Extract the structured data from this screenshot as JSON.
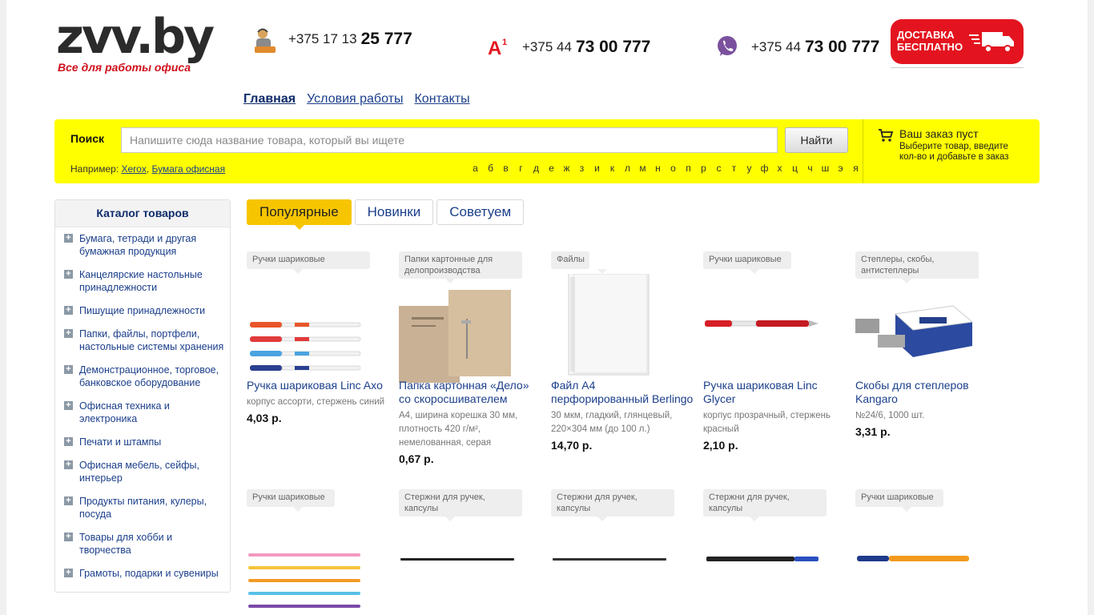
{
  "header": {
    "logo": "zvv.by",
    "tagline": "Все для работы офиса",
    "phones": [
      {
        "prefix": "+375 17 13",
        "main": "25 777",
        "icon": "operator-icon"
      },
      {
        "prefix": "+375 44",
        "main": "73 00 777",
        "icon": "a1-icon"
      },
      {
        "prefix": "+375 44",
        "main": "73 00 777",
        "icon": "viber-icon"
      }
    ],
    "delivery": {
      "line1": "ДОСТАВКА",
      "line2": "БЕСПЛАТНО"
    }
  },
  "nav": {
    "home": "Главная",
    "terms": "Условия работы",
    "contacts": "Контакты"
  },
  "search": {
    "label": "Поиск",
    "placeholder": "Напишите сюда название товара, который вы ищете",
    "button": "Найти",
    "example_label": "Например:",
    "example1": "Xerox",
    "example2": "Бумага офисная",
    "alphabet": [
      "а",
      "б",
      "в",
      "г",
      "д",
      "е",
      "ж",
      "з",
      "и",
      "к",
      "л",
      "м",
      "н",
      "о",
      "п",
      "р",
      "с",
      "т",
      "у",
      "ф",
      "х",
      "ц",
      "ч",
      "ш",
      "э",
      "я"
    ]
  },
  "cart": {
    "title": "Ваш заказ пуст",
    "subtitle": "Выберите товар, введите кол-во и добавьте в заказ"
  },
  "sidebar": {
    "title": "Каталог товаров",
    "items": [
      "Бумага, тетради и другая бумажная продукция",
      "Канцелярские настольные принадлежности",
      "Пишущие принадлежности",
      "Папки, файлы, портфели, настольные системы хранения",
      "Демонстрационное, торговое, банковское оборудование",
      "Офисная техника и электроника",
      "Печати и штампы",
      "Офисная мебель, сейфы, интерьер",
      "Продукты питания, кулеры, посуда",
      "Товары для хобби и творчества",
      "Грамоты, подарки и сувениры"
    ]
  },
  "tabs": [
    "Популярные",
    "Новинки",
    "Советуем"
  ],
  "products": [
    {
      "category": "Ручки шариковые",
      "name": "Ручка шариковая Linc Axo",
      "desc": "корпус ассорти, стержень синий",
      "price": "4,03 р."
    },
    {
      "category": "Папки картонные для делопроизводства",
      "name": "Папка картонная «Дело» со скоросшивателем",
      "desc": "А4, ширина корешка 30 мм, плотность 420 г/м², немелованная, серая",
      "price": "0,67 р."
    },
    {
      "category": "Файлы",
      "name": "Файл А4 перфорированный Berlingo",
      "desc": "30 мкм, гладкий, глянцевый, 220×304 мм (до 100 л.)",
      "price": "14,70 р."
    },
    {
      "category": "Ручки шариковые",
      "name": "Ручка шариковая Linc Glycer",
      "desc": "корпус прозрачный, стержень красный",
      "price": "2,10 р."
    },
    {
      "category": "Степлеры, скобы, антистеплеры",
      "name": "Скобы для степлеров Kangaro",
      "desc": "№24/6, 1000 шт.",
      "price": "3,31 р."
    },
    {
      "category": "Ручки шариковые"
    },
    {
      "category": "Стержни для ручек, капсулы"
    },
    {
      "category": "Стержни для ручек, капсулы"
    },
    {
      "category": "Стержни для ручек, капсулы"
    },
    {
      "category": "Ручки шариковые"
    }
  ]
}
